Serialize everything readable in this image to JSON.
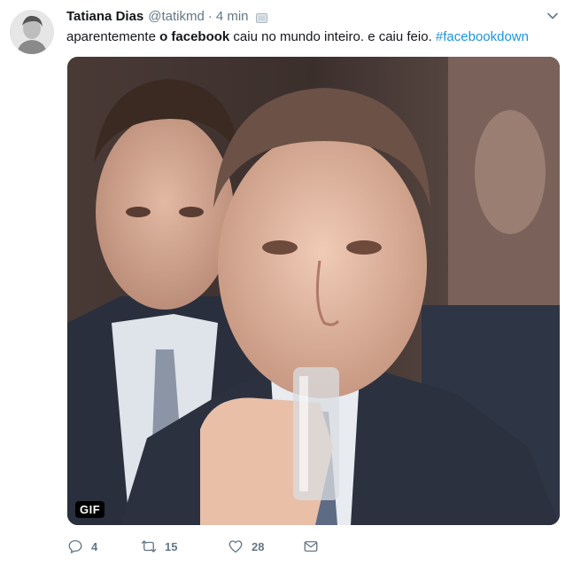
{
  "tweet": {
    "author_name": "Tatiana Dias",
    "handle": "@tatikmd",
    "separator": "·",
    "time": "4 min",
    "text_prefix": "aparentemente ",
    "text_bold": "o facebook",
    "text_mid": " caiu no mundo inteiro. e caiu feio. ",
    "hashtag": "#facebookdown",
    "media_badge": "GIF"
  },
  "actions": {
    "reply_count": "4",
    "retweet_count": "15",
    "like_count": "28"
  },
  "icons": {
    "avatar": "avatar",
    "mobile": "mobile-device-icon",
    "caret": "chevron-down-icon",
    "reply": "reply-icon",
    "retweet": "retweet-icon",
    "like": "heart-icon",
    "dm": "envelope-icon"
  },
  "colors": {
    "link": "#1b95e0",
    "muted": "#657786",
    "text": "#14171a"
  }
}
